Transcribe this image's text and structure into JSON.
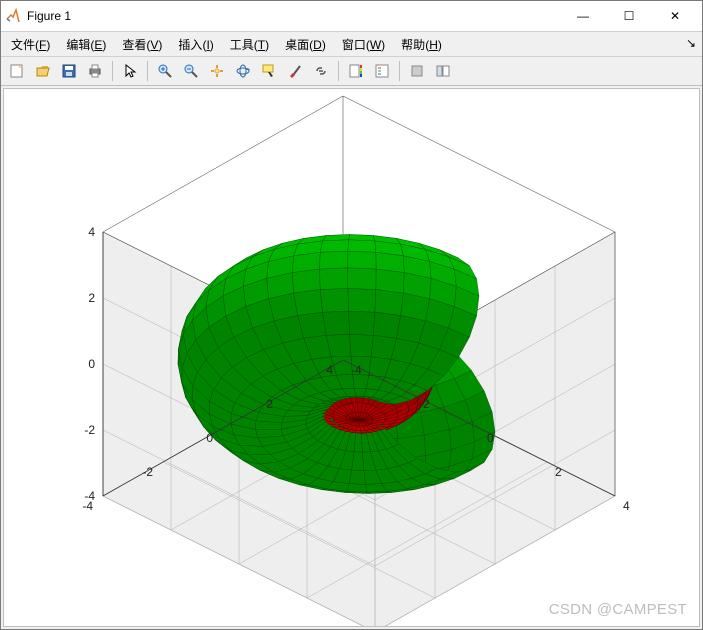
{
  "window": {
    "title": "Figure 1",
    "minimize_glyph": "—",
    "maximize_glyph": "☐",
    "close_glyph": "✕"
  },
  "menu": {
    "file": {
      "label": "文件",
      "key": "F"
    },
    "edit": {
      "label": "编辑",
      "key": "E"
    },
    "view": {
      "label": "查看",
      "key": "V"
    },
    "insert": {
      "label": "插入",
      "key": "I"
    },
    "tools": {
      "label": "工具",
      "key": "T"
    },
    "desktop": {
      "label": "桌面",
      "key": "D"
    },
    "window": {
      "label": "窗口",
      "key": "W"
    },
    "help": {
      "label": "帮助",
      "key": "H"
    },
    "dock_glyph": "↘"
  },
  "toolbar": {
    "new": "new-figure-icon",
    "open": "open-icon",
    "save": "save-icon",
    "print": "print-icon",
    "pointer": "pointer-icon",
    "zoom_in": "zoom-in-icon",
    "zoom_out": "zoom-out-icon",
    "pan": "pan-icon",
    "rotate3d": "rotate-3d-icon",
    "datatip": "data-cursor-icon",
    "brush": "brush-icon",
    "link": "link-icon",
    "colorbar": "colorbar-icon",
    "legend": "legend-icon",
    "hide": "hide-tools-icon",
    "show": "show-tools-icon"
  },
  "watermark": "CSDN @CAMPEST",
  "chart_data": {
    "type": "surface3d",
    "title": "",
    "axes": {
      "x": {
        "lim": [
          -4,
          4
        ],
        "ticks": [
          -4,
          -2,
          0,
          2,
          4
        ],
        "label": ""
      },
      "y": {
        "lim": [
          -4,
          4
        ],
        "ticks": [
          -4,
          -2,
          0,
          2,
          4
        ],
        "label": ""
      },
      "z": {
        "lim": [
          -4,
          4
        ],
        "ticks": [
          -4,
          -2,
          0,
          2,
          4
        ],
        "label": ""
      }
    },
    "grid": true,
    "box": true,
    "view_approx": {
      "azimuth_deg": -37.5,
      "elevation_deg": 30
    },
    "surfaces": [
      {
        "name": "outer",
        "shape": "torus",
        "color": "#00c000",
        "edge": "#004000",
        "major_radius": 2.0,
        "minor_radius": 2.0,
        "center": [
          0,
          0,
          0
        ],
        "cutaway": {
          "quadrant": "x>=0 & y<=0"
        }
      },
      {
        "name": "inner",
        "shape": "sphere",
        "color": "#c00000",
        "edge": "#400000",
        "radius": 1.7,
        "center": [
          0,
          0,
          0
        ]
      }
    ],
    "tick_labels": {
      "z_left": [
        "4",
        "2",
        "0",
        "-2",
        "-4"
      ],
      "x_front": [
        "4",
        "2",
        "0",
        "-2",
        "-4"
      ],
      "y_front": [
        "-4",
        "-2",
        "0",
        "2",
        "4"
      ]
    },
    "colors": {
      "grid": "#b0b0b0",
      "panel": "#eeeeee",
      "axis": "#333333",
      "surface_green": "#00c000",
      "surface_green_dark": "#007000",
      "surface_red": "#c00000",
      "surface_red_dark": "#700000"
    }
  }
}
